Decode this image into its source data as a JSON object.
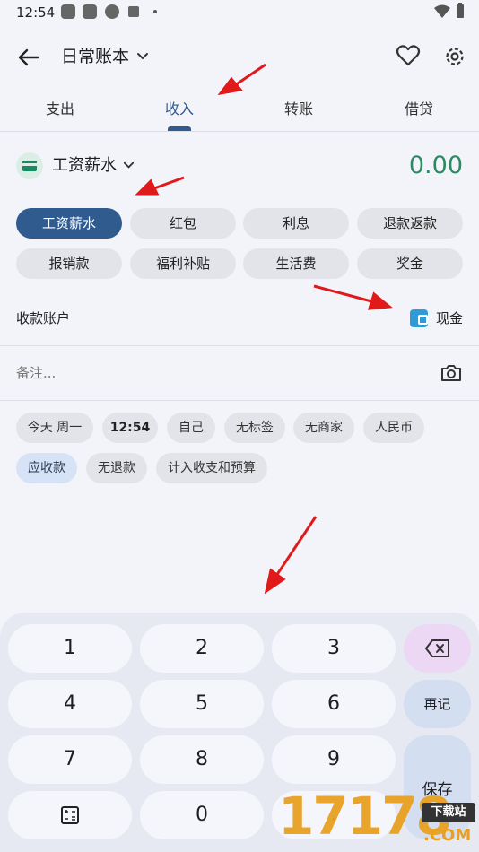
{
  "status_bar": {
    "time": "12:54"
  },
  "header": {
    "book_title": "日常账本"
  },
  "tabs": [
    {
      "label": "支出"
    },
    {
      "label": "收入"
    },
    {
      "label": "转账"
    },
    {
      "label": "借贷"
    }
  ],
  "category": {
    "name": "工资薪水",
    "amount": "0.00"
  },
  "chips": [
    {
      "label": "工资薪水"
    },
    {
      "label": "红包"
    },
    {
      "label": "利息"
    },
    {
      "label": "退款返款"
    },
    {
      "label": "报销款"
    },
    {
      "label": "福利补贴"
    },
    {
      "label": "生活费"
    },
    {
      "label": "奖金"
    }
  ],
  "account": {
    "label": "收款账户",
    "name": "现金"
  },
  "note": {
    "placeholder": "备注..."
  },
  "tags": [
    {
      "label": "今天 周一"
    },
    {
      "label": "12:54"
    },
    {
      "label": "自己"
    },
    {
      "label": "无标签"
    },
    {
      "label": "无商家"
    },
    {
      "label": "人民币"
    },
    {
      "label": "应收款"
    },
    {
      "label": "无退款"
    },
    {
      "label": "计入收支和预算"
    }
  ],
  "keypad": {
    "keys": [
      "1",
      "2",
      "3",
      "4",
      "5",
      "6",
      "7",
      "8",
      "9",
      "0",
      "."
    ],
    "again_label": "再记",
    "save_label": "保存"
  },
  "watermark": {
    "digits": "17178",
    "tag": "下载站",
    "suffix": ".COM"
  },
  "colors": {
    "accent": "#2f5b8f",
    "amount": "#2b8a62",
    "arrow": "#e01a1a"
  }
}
